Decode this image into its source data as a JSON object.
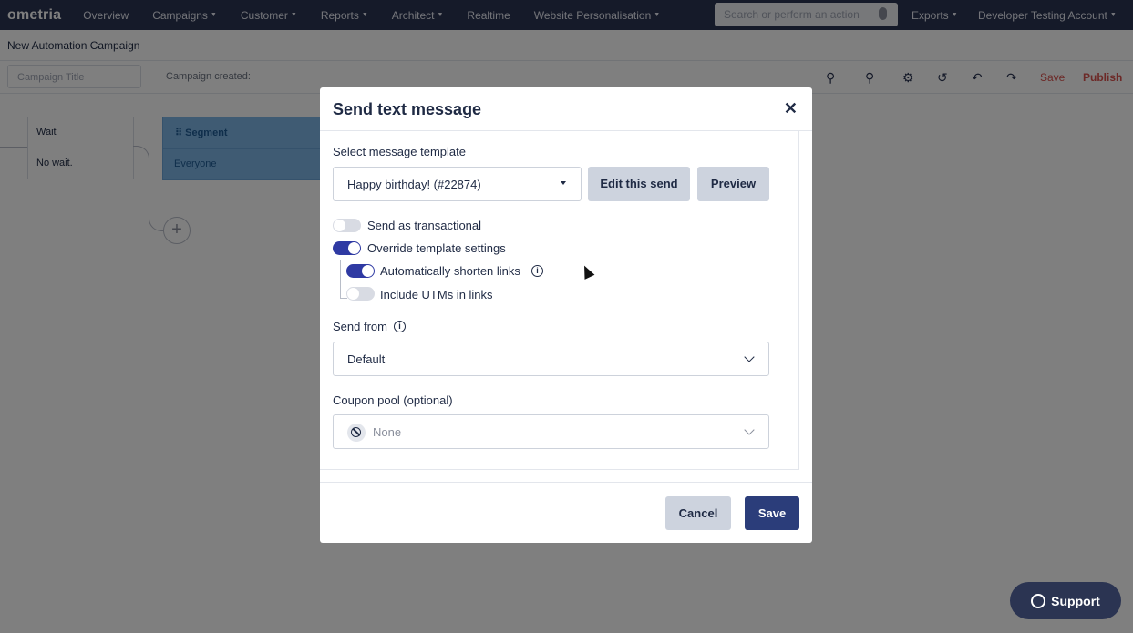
{
  "nav": {
    "logo": "ometria",
    "items": [
      {
        "label": "Overview",
        "caret": false
      },
      {
        "label": "Campaigns",
        "caret": true
      },
      {
        "label": "Customer",
        "caret": true
      },
      {
        "label": "Reports",
        "caret": true
      },
      {
        "label": "Architect",
        "caret": true
      },
      {
        "label": "Realtime",
        "caret": false
      },
      {
        "label": "Website Personalisation",
        "caret": true
      }
    ],
    "search_placeholder": "Search or perform an action",
    "exports": "Exports",
    "account": "Developer Testing Account"
  },
  "page": {
    "title": "New Automation Campaign",
    "campaign_title_placeholder": "Campaign Title",
    "campaign_created": "Campaign created:",
    "save": "Save",
    "publish": "Publish"
  },
  "canvas": {
    "wait_node": {
      "title": "Wait",
      "body": "No wait."
    },
    "segment_node": {
      "title": "Segment",
      "body": "Everyone"
    }
  },
  "modal": {
    "title": "Send text message",
    "select_template_label": "Select message template",
    "template_value": "Happy birthday! (#22874)",
    "edit_button": "Edit this send",
    "preview_button": "Preview",
    "toggles": [
      {
        "label": "Send as transactional",
        "on": false
      },
      {
        "label": "Override template settings",
        "on": true
      },
      {
        "label": "Automatically shorten links",
        "on": true
      },
      {
        "label": "Include UTMs in links",
        "on": false
      }
    ],
    "send_from_label": "Send from",
    "send_from_value": "Default",
    "coupon_label": "Coupon pool (optional)",
    "coupon_value": "None",
    "cancel": "Cancel",
    "save": "Save"
  },
  "support": "Support"
}
